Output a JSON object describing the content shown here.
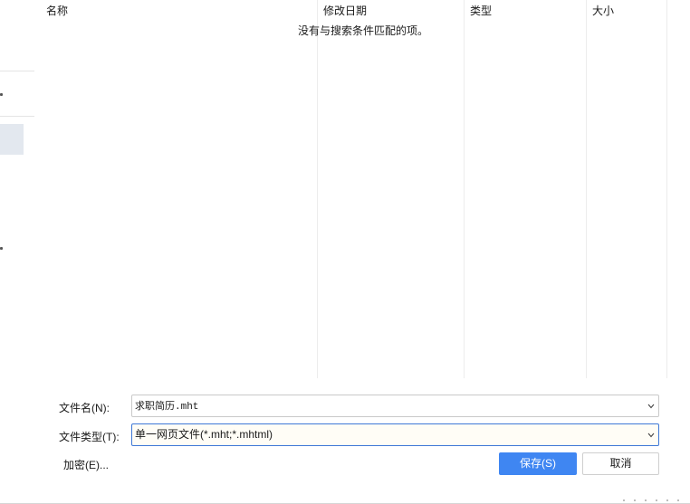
{
  "list": {
    "columns": [
      {
        "label": "名称"
      },
      {
        "label": "修改日期"
      },
      {
        "label": "类型"
      },
      {
        "label": "大小"
      }
    ],
    "empty_message": "没有与搜索条件匹配的项。"
  },
  "form": {
    "filename_label": "文件名(N):",
    "filename_value": "求职简历.mht",
    "filetype_label": "文件类型(T):",
    "filetype_value": "单一网页文件(*.mht;*.mhtml)",
    "encrypt_link": "加密(E)..."
  },
  "buttons": {
    "save": "保存(S)",
    "cancel": "取消"
  },
  "colors": {
    "accent": "#3f86f2",
    "focus_border": "#3f78d6",
    "selected_nav": "#e3e8ef"
  },
  "icons": {
    "dropdown": "chevron-down-icon",
    "sort": "sort-up-icon"
  }
}
